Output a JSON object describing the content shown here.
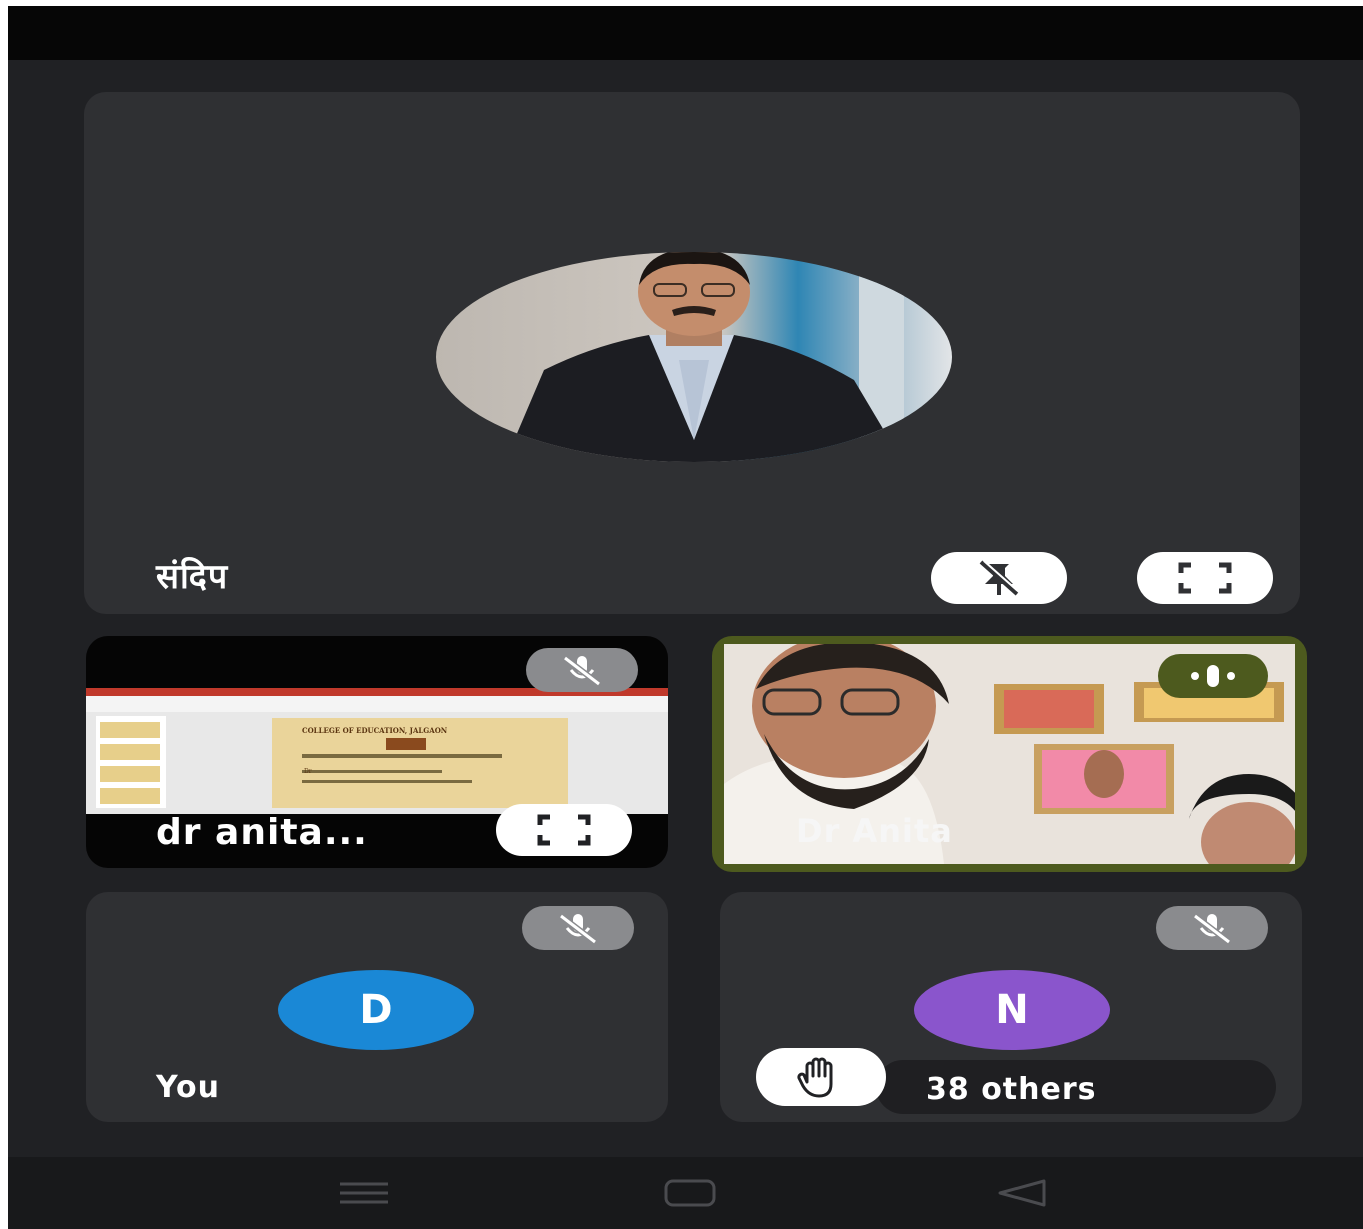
{
  "participants": {
    "main": {
      "name": "संदिप",
      "pin_icon": "pin-off-icon",
      "expand_icon": "fullscreen-icon"
    },
    "presentation": {
      "name": "dr anita...",
      "slide_lines": [
        "COLLEGE OF EDUCATION, JALGAON",
        "Dr"
      ],
      "mute_icon": "mic-off-icon",
      "expand_icon": "fullscreen-icon"
    },
    "speaker": {
      "name": "Dr Anita",
      "speaking_icon": "audio-level-icon",
      "accent": "#4d5a1e"
    },
    "self": {
      "name": "You",
      "initial": "D",
      "avatar_color": "#1a88d6",
      "mute_icon": "mic-off-icon"
    },
    "others": {
      "label": "38 others",
      "initial": "N",
      "avatar_color": "#8a55cc",
      "mute_icon": "mic-off-icon",
      "hand_icon": "raised-hand-icon"
    }
  },
  "nav": {
    "menu_icon": "recents-icon",
    "home_icon": "home-icon",
    "back_icon": "back-icon"
  }
}
